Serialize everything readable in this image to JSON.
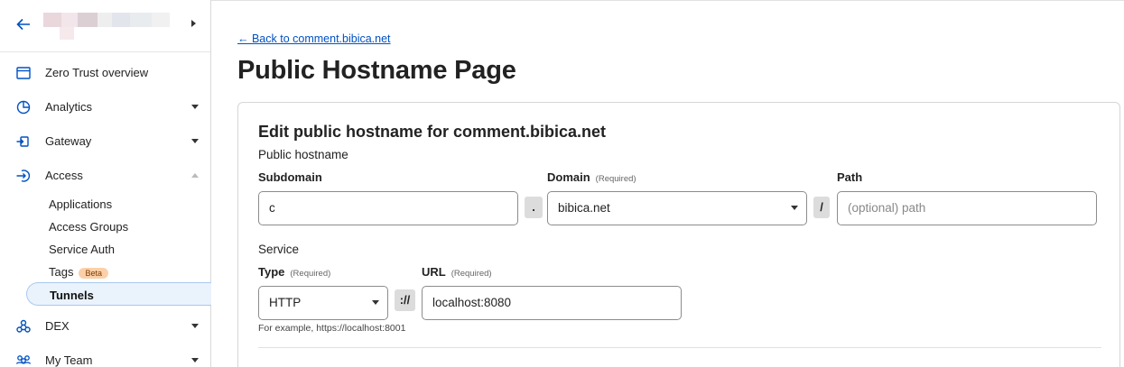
{
  "sidebar": {
    "nav": [
      {
        "label": "Zero Trust overview",
        "icon": "browser-window-icon"
      },
      {
        "label": "Analytics",
        "icon": "pie-chart-icon"
      },
      {
        "label": "Gateway",
        "icon": "gateway-icon"
      },
      {
        "label": "Access",
        "icon": "access-login-icon"
      },
      {
        "label": "DEX",
        "icon": "network-nodes-icon"
      },
      {
        "label": "My Team",
        "icon": "team-icon"
      }
    ],
    "access_sub": [
      {
        "label": "Applications"
      },
      {
        "label": "Access Groups"
      },
      {
        "label": "Service Auth"
      },
      {
        "label": "Tags",
        "badge": "Beta"
      },
      {
        "label": "Tunnels"
      }
    ]
  },
  "main": {
    "back_link": "← Back to comment.bibica.net",
    "page_title": "Public Hostname Page",
    "card": {
      "title": "Edit public hostname for comment.bibica.net",
      "public_hostname_label": "Public hostname",
      "subdomain": {
        "label": "Subdomain",
        "value": "c"
      },
      "dot_sep": ".",
      "domain": {
        "label": "Domain",
        "required": "(Required)",
        "value": "bibica.net"
      },
      "slash_sep": "/",
      "path": {
        "label": "Path",
        "placeholder": "(optional) path"
      },
      "service_label": "Service",
      "type": {
        "label": "Type",
        "required": "(Required)",
        "value": "HTTP"
      },
      "scheme_sep": "://",
      "url": {
        "label": "URL",
        "required": "(Required)",
        "value": "localhost:8080"
      },
      "hint": "For example, https://localhost:8001"
    }
  },
  "colors": {
    "accent": "#0051c3",
    "beta_badge_bg": "#fbd0a8",
    "active_bg": "#eaf2fc"
  }
}
